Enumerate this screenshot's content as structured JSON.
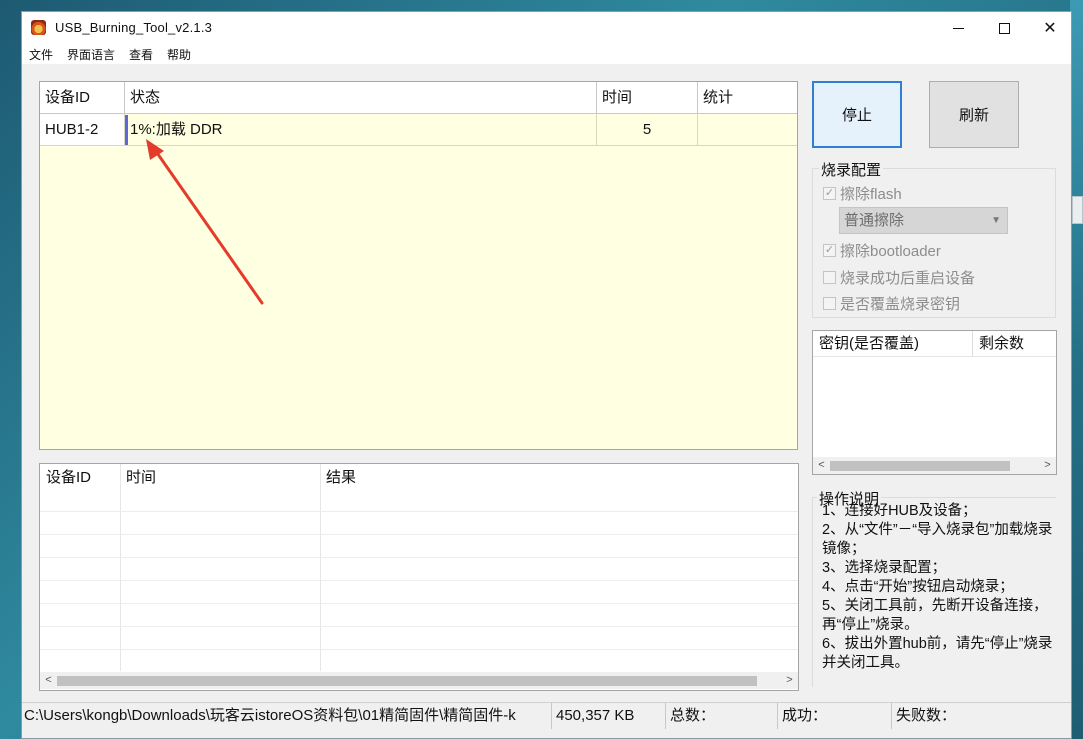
{
  "window": {
    "title": "USB_Burning_Tool_v2.1.3"
  },
  "menu": [
    "文件",
    "界面语言",
    "查看",
    "帮助"
  ],
  "device_grid": {
    "headers": [
      "设备ID",
      "状态",
      "时间",
      "统计"
    ],
    "rows": [
      {
        "device_id": "HUB1-2",
        "status": "1%:加载 DDR",
        "time": "5",
        "stats": ""
      }
    ]
  },
  "buttons": {
    "stop": "停止",
    "refresh": "刷新"
  },
  "burn_config": {
    "title": "烧录配置",
    "erase_flash": {
      "label": "擦除flash",
      "checked": true
    },
    "erase_mode": "普通擦除",
    "erase_bootloader": {
      "label": "擦除bootloader",
      "checked": true
    },
    "reboot_after": {
      "label": "烧录成功后重启设备",
      "checked": false
    },
    "overwrite_key": {
      "label": "是否覆盖烧录密钥",
      "checked": false
    }
  },
  "key_table": {
    "headers": [
      "密钥(是否覆盖)",
      "剩余数"
    ]
  },
  "log_table": {
    "headers": [
      "设备ID",
      "时间",
      "结果"
    ]
  },
  "instructions": {
    "title": "操作说明",
    "lines": [
      "1、连接好HUB及设备；",
      "2、从“文件”－“导入烧录包”加载烧录镜像；",
      "3、选择烧录配置；",
      "4、点击“开始”按钮启动烧录；",
      "5、关闭工具前，先断开设备连接，再“停止”烧录。",
      "6、拔出外置hub前，请先“停止”烧录并关闭工具。"
    ]
  },
  "status_bar": {
    "path": "C:\\Users\\kongb\\Downloads\\玩客云istoreOS资料包\\01精简固件\\精简固件-k",
    "size": "450,357 KB",
    "total": "总数：",
    "success": "成功：",
    "failed": "失败数："
  },
  "colors": {
    "grid_bg": "#ffffe1",
    "annotation_arrow": "#e53b2c",
    "selection_bar": "#5a68d8"
  }
}
